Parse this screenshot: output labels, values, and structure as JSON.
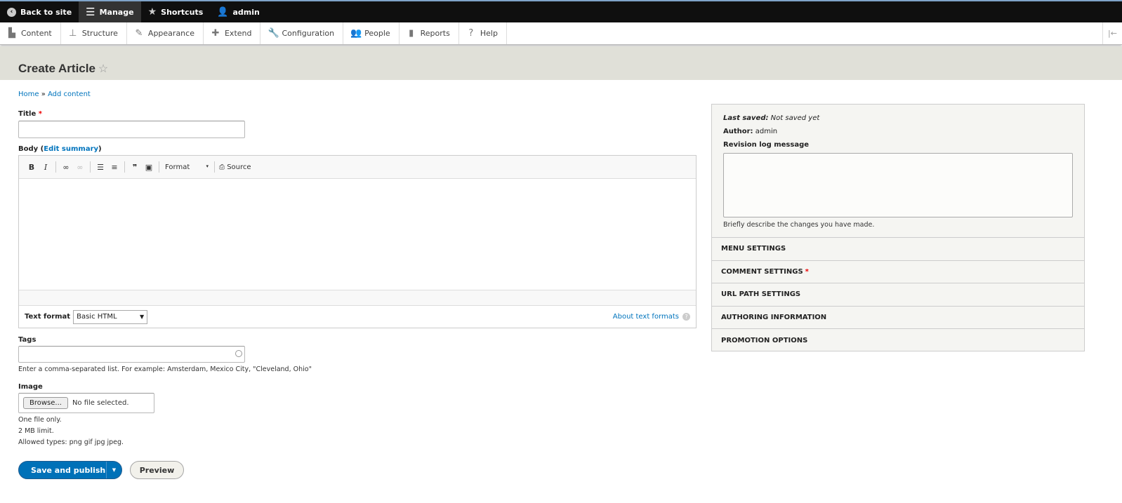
{
  "topbar": {
    "back": "Back to site",
    "manage": "Manage",
    "shortcuts": "Shortcuts",
    "user": "admin"
  },
  "nav": [
    {
      "label": "Content",
      "icon": "file-icon",
      "glyph": "▙"
    },
    {
      "label": "Structure",
      "icon": "sitemap-icon",
      "glyph": "⊥"
    },
    {
      "label": "Appearance",
      "icon": "brush-icon",
      "glyph": "✎"
    },
    {
      "label": "Extend",
      "icon": "puzzle-icon",
      "glyph": "✚"
    },
    {
      "label": "Configuration",
      "icon": "wrench-icon",
      "glyph": "🔧"
    },
    {
      "label": "People",
      "icon": "people-icon",
      "glyph": "👥"
    },
    {
      "label": "Reports",
      "icon": "bar-chart-icon",
      "glyph": "▮"
    },
    {
      "label": "Help",
      "icon": "help-icon",
      "glyph": "?"
    }
  ],
  "page": {
    "title": "Create Article"
  },
  "breadcrumb": {
    "home": "Home",
    "sep": " » ",
    "add": "Add content"
  },
  "form": {
    "title_label": "Title",
    "required": "*",
    "body_label": "Body (",
    "edit_summary": "Edit summary",
    "body_close": ")",
    "toolbar": {
      "bold": "B",
      "italic": "I",
      "blockquote": "❞",
      "format": "Format",
      "source": "Source"
    },
    "text_format_label": "Text format",
    "text_format_value": "Basic HTML",
    "about_formats": "About text formats",
    "tags_label": "Tags",
    "tags_desc": "Enter a comma-separated list. For example: Amsterdam, Mexico City, \"Cleveland, Ohio\"",
    "image_label": "Image",
    "browse": "Browse...",
    "no_file": "No file selected.",
    "image_desc": [
      "One file only.",
      "2 MB limit.",
      "Allowed types: png gif jpg jpeg."
    ],
    "save": "Save and publish",
    "preview": "Preview"
  },
  "sidebar": {
    "last_saved_label": "Last saved:",
    "last_saved_value": " Not saved yet",
    "author_label": "Author:",
    "author_value": " admin",
    "revision_label": "Revision log message",
    "revision_desc": "Briefly describe the changes you have made.",
    "sections": [
      "MENU SETTINGS",
      "COMMENT SETTINGS",
      "URL PATH SETTINGS",
      "AUTHORING INFORMATION",
      "PROMOTION OPTIONS"
    ]
  },
  "colors": {
    "accent": "#0074bd",
    "required": "#e00000",
    "primary_button": "#0071b8"
  }
}
